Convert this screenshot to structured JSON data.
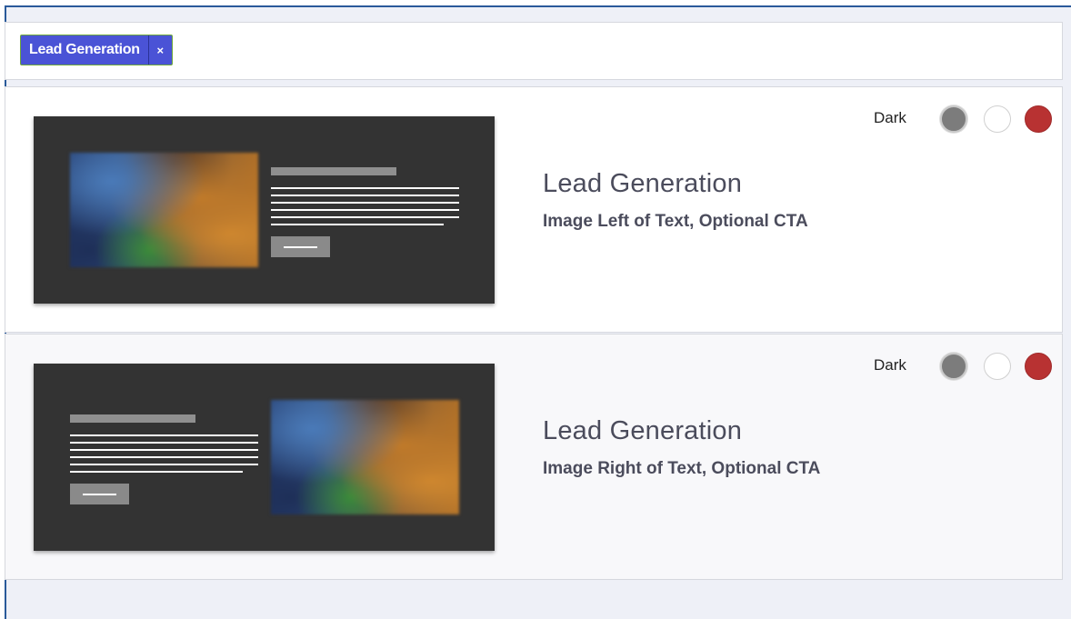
{
  "filter": {
    "tag_label": "Lead Generation",
    "tag_remove": "×"
  },
  "colors": {
    "tag": "#4a53d6",
    "swatch_gray": "#7c7c7c",
    "swatch_white": "#ffffff",
    "swatch_red": "#b83232",
    "thumbnail_bg": "#333333"
  },
  "cards": [
    {
      "title": "Lead Generation",
      "subtitle": "Image Left of Text, Optional CTA",
      "theme_label": "Dark",
      "layout": "image-left"
    },
    {
      "title": "Lead Generation",
      "subtitle": "Image Right of Text, Optional CTA",
      "theme_label": "Dark",
      "layout": "image-right"
    }
  ]
}
